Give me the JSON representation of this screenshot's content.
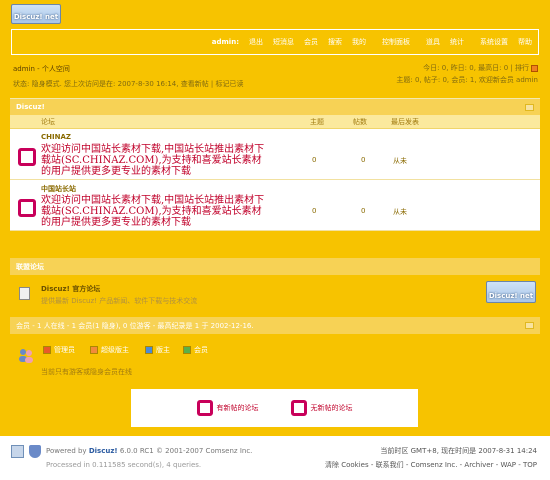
{
  "logo": {
    "text": "Discuz! net"
  },
  "nav": {
    "user": "admin:",
    "items": [
      "退出",
      "短消息",
      "会员",
      "搜索",
      "我的",
      "控制面板",
      "道具",
      "统计",
      "系统设置",
      "帮助"
    ]
  },
  "breadcrumb": "admin  - 个人空间",
  "welcome": "状态: 隐身模式. 您上次访问是在: 2007-8-30 16:14, 查看新帖 | 标记已读",
  "stats": {
    "line1": "今日: 0, 昨日: 0, 最高日: 0 | 排行",
    "line2": "主题: 0, 帖子: 0, 会员: 1, 欢迎新会员 admin"
  },
  "forum_section": {
    "title": "Discuz!",
    "columns": {
      "forum": "论坛",
      "topics": "主题",
      "posts": "帖数",
      "last": "最后发表"
    },
    "rows": [
      {
        "name": "CHINAZ",
        "desc": "欢迎访问中国站长素材下载,中国站长站推出素材下载站(SC.CHINAZ.COM),为支持和喜爱站长素材的用户提供更多更专业的素材下载",
        "topics": "0",
        "posts": "0",
        "last": "从未"
      },
      {
        "name": "中国站长站",
        "desc": "欢迎访问中国站长素材下载,中国站长站推出素材下载站(SC.CHINAZ.COM),为支持和喜爱站长素材的用户提供更多更专业的素材下载",
        "topics": "0",
        "posts": "0",
        "last": "从未"
      }
    ]
  },
  "links": {
    "title": "联盟论坛",
    "name": "Discuz! 官方论坛",
    "desc": "提供最新 Discuz! 产品新闻、软件下载与技术交流",
    "logo": "Discuz! net"
  },
  "online": {
    "summary": "会员 - 1 人在线 - 1 会员(1 隐身), 0 位游客 - 最高纪录是 1 于 2002-12-16.",
    "legend": [
      {
        "label": "管理员",
        "color": "#e85a2a"
      },
      {
        "label": "超级版主",
        "color": "#f28a3a"
      },
      {
        "label": "版主",
        "color": "#4a8ad8"
      },
      {
        "label": "会员",
        "color": "#5ab04a"
      }
    ],
    "note": "当前只有游客或隐身会员在线"
  },
  "icon_legend": {
    "new": "有新帖的论坛",
    "nonew": "无新帖的论坛"
  },
  "footer": {
    "powered_prefix": "Powered by",
    "brand": "Discuz!",
    "powered_suffix": "6.0.0 RC1 © 2001-2007 Comsenz Inc.",
    "processed": "Processed in 0.111585 second(s), 4 queries.",
    "timezone": "当前时区 GMT+8, 现在时间是 2007-8-31 14:24",
    "links": "清除 Cookies - 联系我们 - Comsenz Inc. - Archiver - WAP - TOP"
  }
}
